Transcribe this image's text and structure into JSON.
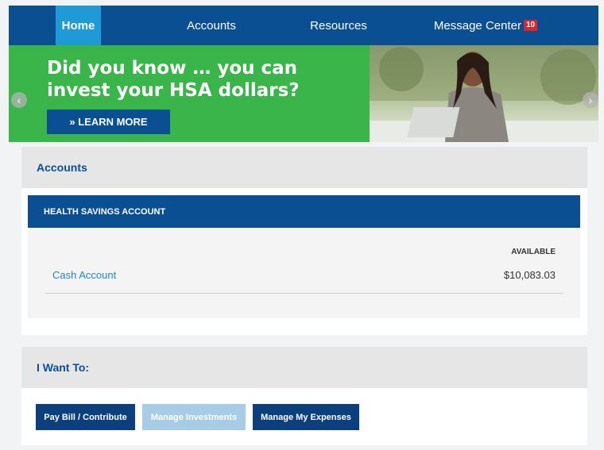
{
  "nav": {
    "home": "Home",
    "accounts": "Accounts",
    "resources": "Resources",
    "message_center": "Message Center",
    "message_count": "10"
  },
  "banner": {
    "headline": "Did you know … you can invest your HSA dollars?",
    "cta": "» LEARN MORE"
  },
  "accounts_panel": {
    "title": "Accounts",
    "section": "HEALTH SAVINGS ACCOUNT",
    "column_header": "AVAILABLE",
    "rows": [
      {
        "name": "Cash Account",
        "available": "$10,083.03"
      }
    ]
  },
  "actions_panel": {
    "title": "I Want To:",
    "buttons": [
      "Pay Bill / Contribute",
      "Manage Investments",
      "Manage My Expenses"
    ]
  },
  "colors": {
    "nav_bg": "#0b4f93",
    "nav_active": "#1e9bd7",
    "banner_green": "#39b54a",
    "link": "#1e88c8",
    "badge": "#d8262d"
  }
}
